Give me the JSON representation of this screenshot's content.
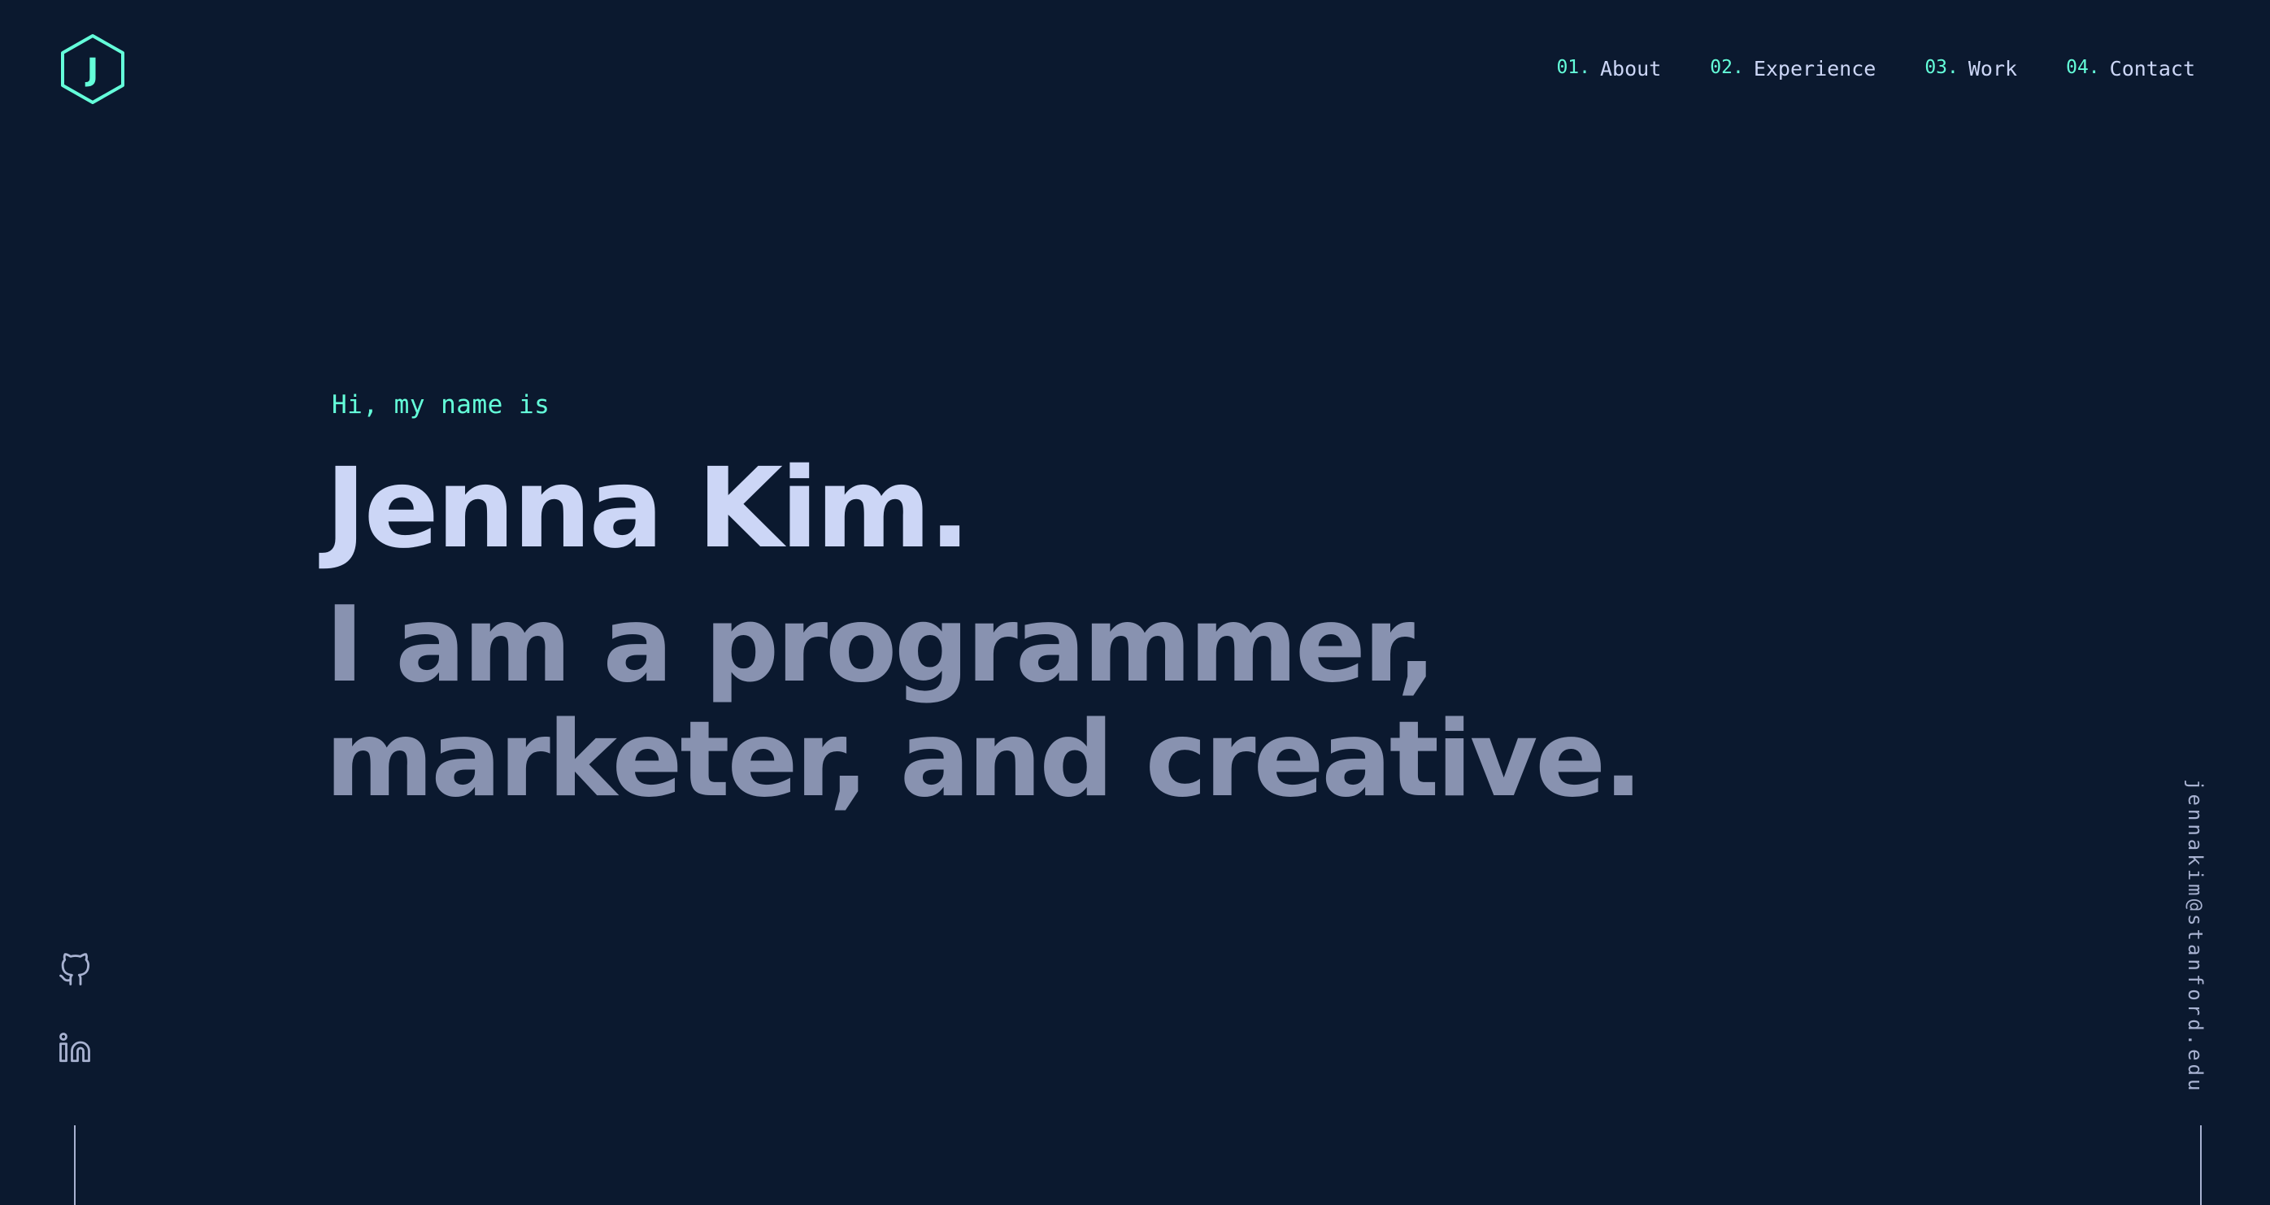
{
  "logo": {
    "letter": "J",
    "icon": "hexagon-logo-icon"
  },
  "nav": {
    "items": [
      {
        "num": "01.",
        "label": "About"
      },
      {
        "num": "02.",
        "label": "Experience"
      },
      {
        "num": "03.",
        "label": "Work"
      },
      {
        "num": "04.",
        "label": "Contact"
      }
    ]
  },
  "hero": {
    "greeting": "Hi, my name is",
    "name": "Jenna Kim.",
    "tagline": "I am a programmer, marketer, and creative."
  },
  "social": {
    "links": [
      {
        "icon": "github-icon"
      },
      {
        "icon": "linkedin-icon"
      }
    ]
  },
  "email": "jennakim@stanford.edu",
  "colors": {
    "background": "#0b192f",
    "accent": "#64ffda",
    "heading": "#ccd6f6",
    "subheading": "#8892b0",
    "muted": "#a8b2d1"
  }
}
